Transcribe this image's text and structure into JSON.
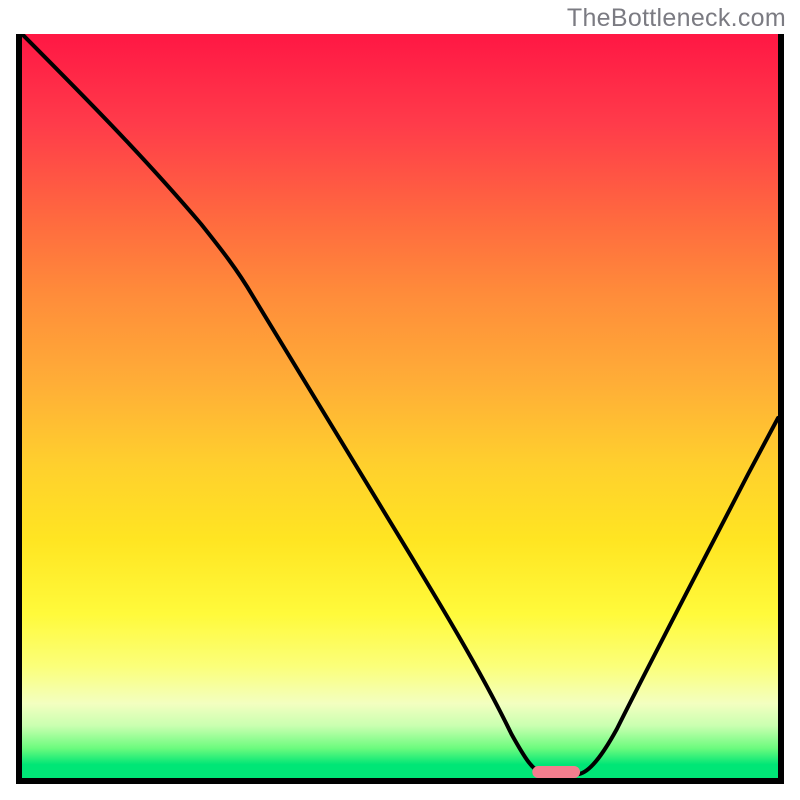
{
  "watermark": "TheBottleneck.com",
  "chart_data": {
    "type": "line",
    "title": "",
    "xlabel": "",
    "ylabel": "",
    "x_range": [
      0,
      100
    ],
    "y_range": [
      0,
      100
    ],
    "note": "Axes have no visible tick labels; x and y normalized 0–100. Curve values estimated from image.",
    "series": [
      {
        "name": "curve",
        "x": [
          0,
          6,
          12,
          18,
          24,
          28,
          32,
          38,
          44,
          50,
          55,
          60,
          63,
          66,
          68,
          72,
          75,
          78,
          82,
          86,
          90,
          94,
          98,
          100
        ],
        "y": [
          100,
          93,
          86,
          79,
          73,
          69,
          64,
          55,
          45,
          36,
          27,
          18,
          12,
          6,
          3,
          1,
          1,
          2,
          8,
          16,
          26,
          36,
          47,
          52
        ]
      }
    ],
    "marker": {
      "name": "highlight-pill",
      "center_x": 70,
      "y": 0.3,
      "width": 5,
      "color": "#F47E8E"
    },
    "background_gradient": {
      "top": "#FF1744",
      "mid": "#FFD02D",
      "low": "#FBFF7A",
      "bottom": "#00E676"
    }
  }
}
